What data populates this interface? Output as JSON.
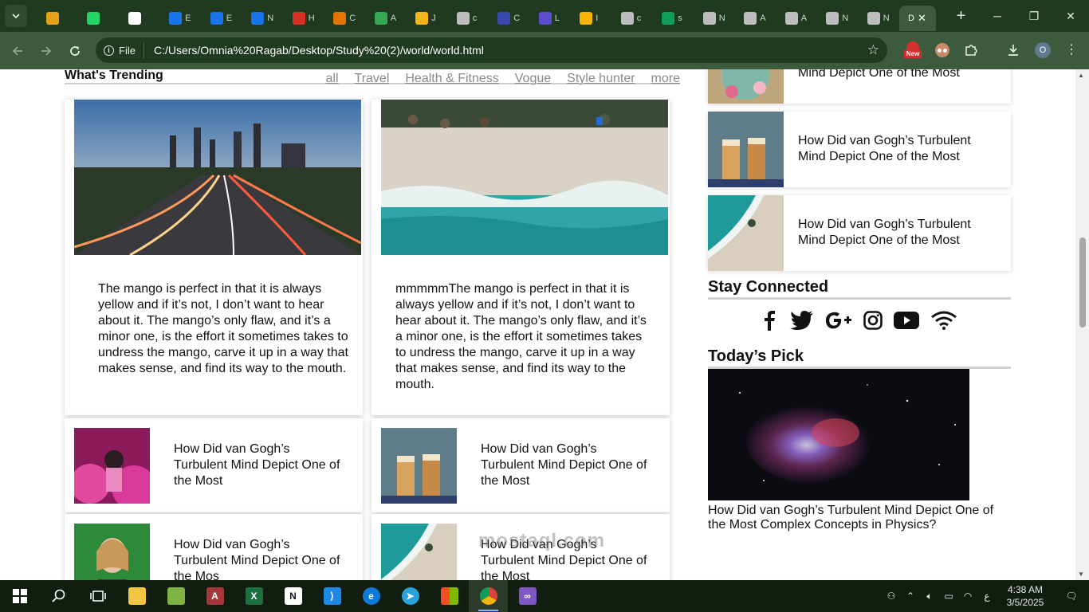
{
  "browser": {
    "tabs": [
      {
        "letter": "",
        "color": "#e3a21a"
      },
      {
        "letter": "",
        "color": "#25d366"
      },
      {
        "letter": "",
        "color": "#ffffff"
      },
      {
        "letter": "E",
        "color": "#1a73e8"
      },
      {
        "letter": "E",
        "color": "#1a73e8"
      },
      {
        "letter": "N",
        "color": "#1a73e8"
      },
      {
        "letter": "H",
        "color": "#d93025"
      },
      {
        "letter": "C",
        "color": "#e37400"
      },
      {
        "letter": "A",
        "color": "#34a853"
      },
      {
        "letter": "J",
        "color": "#f6b51b"
      },
      {
        "letter": "c",
        "color": "#bdbdbd"
      },
      {
        "letter": "C",
        "color": "#3949ab"
      },
      {
        "letter": "L",
        "color": "#5c4dcf"
      },
      {
        "letter": "I",
        "color": "#f4b400"
      },
      {
        "letter": "c",
        "color": "#bdbdbd"
      },
      {
        "letter": "s",
        "color": "#0f9d58"
      },
      {
        "letter": "N",
        "color": "#bdbdbd"
      },
      {
        "letter": "A",
        "color": "#bdbdbd"
      },
      {
        "letter": "A",
        "color": "#bdbdbd"
      },
      {
        "letter": "N",
        "color": "#bdbdbd"
      },
      {
        "letter": "N",
        "color": "#bdbdbd"
      }
    ],
    "active_tab_letter": "D",
    "site_label": "File",
    "url": "C:/Users/Omnia%20Ragab/Desktop/Study%20(2)/world/world.html",
    "new_badge": "New",
    "profile_letter": "O"
  },
  "trending": {
    "title": "What's Trending",
    "nav": [
      "all",
      "Travel",
      "Health & Fitness",
      "Vogue",
      "Style hunter",
      "more"
    ],
    "cards": [
      {
        "text": "The mango is perfect in that it is always yellow and if it’s not, I don’t want to hear about it. The mango’s only flaw, and it’s a minor one, is the effort it sometimes takes to undress the mango, carve it up in a way that makes sense, and find its way to the mouth."
      },
      {
        "text": "mmmmmThe mango is perfect in that it is always yellow and if it’s not, I don’t want to hear about it. The mango’s only flaw, and it’s a minor one, is the effort it sometimes takes to undress the mango, carve it up in a way that makes sense, and find its way to the mouth."
      }
    ],
    "mini_posts": [
      {
        "title": "How Did van Gogh’s Turbulent Mind Depict One of the Most"
      },
      {
        "title": "How Did van Gogh’s Turbulent Mind Depict One of the Most"
      },
      {
        "title": "How Did van Gogh’s Turbulent Mind Depict One of the Mos"
      },
      {
        "title": "How Did van Gogh’s Turbulent Mind Depict One of the Most"
      }
    ]
  },
  "sidebar": {
    "posts": [
      {
        "title": "Mind Depict One of the Most"
      },
      {
        "title": "How Did van Gogh’s Turbulent Mind Depict One of the Most"
      },
      {
        "title": "How Did van Gogh’s Turbulent Mind Depict One of the Most"
      }
    ],
    "stay_connected_title": "Stay Connected",
    "social_icons": [
      "facebook-icon",
      "twitter-icon",
      "google-plus-icon",
      "instagram-icon",
      "youtube-icon",
      "rss-icon"
    ],
    "todays_pick_title": "Today’s Pick",
    "todays_pick_caption": "How Did van Gogh’s Turbulent Mind Depict One of the Most Complex Concepts in Physics?"
  },
  "watermark": "mostaql.com",
  "taskbar": {
    "time": "4:38 AM",
    "date": "3/5/2025",
    "lang": "ع"
  },
  "colors": {
    "chrome_dark": "#1f3a1f",
    "chrome_toolbar": "#3c5a3c",
    "taskbar": "#101d10"
  }
}
